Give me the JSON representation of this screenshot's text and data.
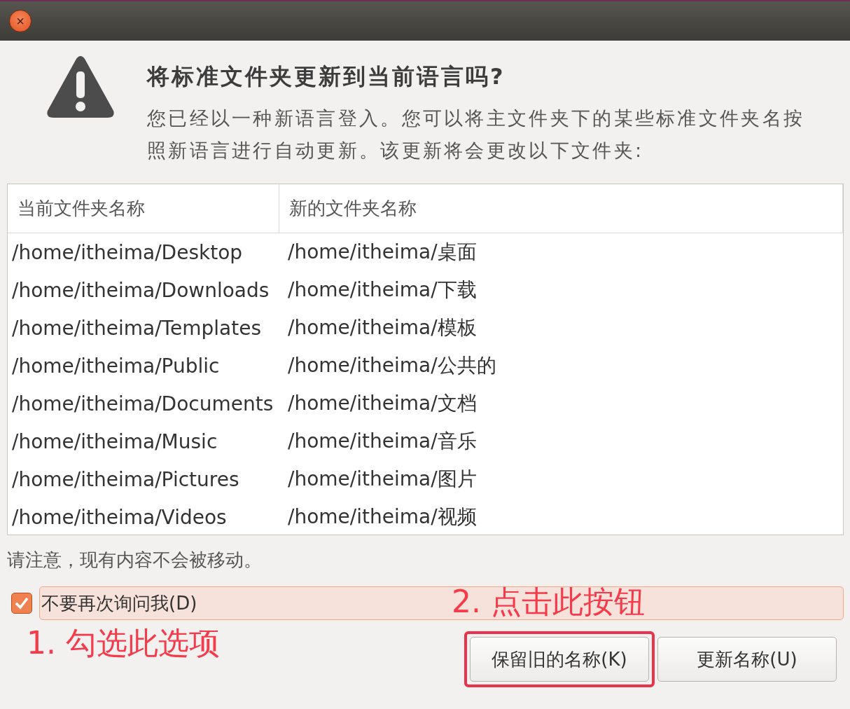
{
  "window": {
    "close_button": "×"
  },
  "dialog": {
    "heading": "将标准文件夹更新到当前语言吗?",
    "message": "您已经以一种新语言登入。您可以将主文件夹下的某些标准文件夹名按照新语言进行自动更新。该更新将会更改以下文件夹:"
  },
  "table": {
    "columns": [
      "当前文件夹名称",
      "新的文件夹名称"
    ],
    "rows": [
      [
        "/home/itheima/Desktop",
        "/home/itheima/桌面"
      ],
      [
        "/home/itheima/Downloads",
        "/home/itheima/下载"
      ],
      [
        "/home/itheima/Templates",
        "/home/itheima/模板"
      ],
      [
        "/home/itheima/Public",
        "/home/itheima/公共的"
      ],
      [
        "/home/itheima/Documents",
        "/home/itheima/文档"
      ],
      [
        "/home/itheima/Music",
        "/home/itheima/音乐"
      ],
      [
        "/home/itheima/Pictures",
        "/home/itheima/图片"
      ],
      [
        "/home/itheima/Videos",
        "/home/itheima/视频"
      ]
    ]
  },
  "note": "请注意，现有内容不会被移动。",
  "checkbox": {
    "label": "不要再次询问我(D)",
    "checked": true
  },
  "buttons": [
    {
      "label": "保留旧的名称(K)",
      "highlighted": true
    },
    {
      "label": "更新名称(U)",
      "highlighted": false
    }
  ],
  "annotations": [
    {
      "text": "1. 勾选此选项"
    },
    {
      "text": "2. 点击此按钮"
    }
  ]
}
